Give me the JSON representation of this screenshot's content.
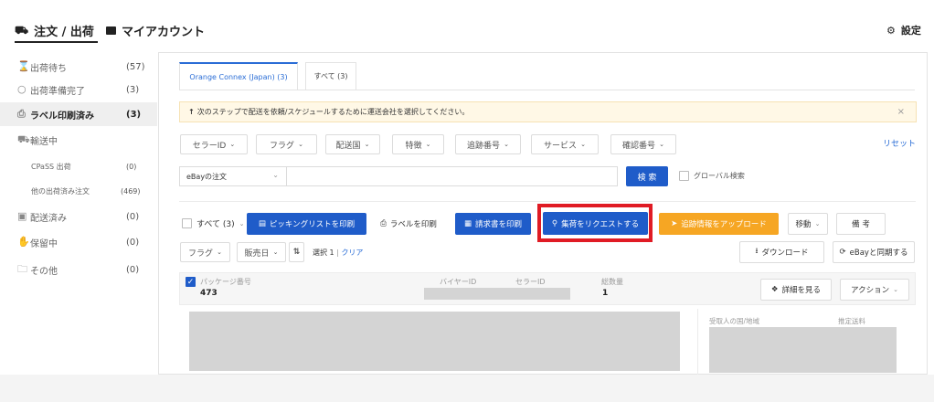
{
  "topnav": {
    "orders_label": "注文 / 出荷",
    "account_label": "マイアカウント",
    "settings_label": "設定"
  },
  "sidebar": {
    "items": [
      {
        "label": "出荷待ち",
        "count": "(57)",
        "icon": "hourglass-icon"
      },
      {
        "label": "出荷準備完了",
        "count": "(3)",
        "icon": "box-icon"
      },
      {
        "label": "ラベル印刷済み",
        "count": "(3)",
        "icon": "printer-icon"
      },
      {
        "label": "輸送中",
        "count": "",
        "icon": "truck-icon"
      },
      {
        "label": "CPaSS 出荷",
        "count": "(0)",
        "icon": ""
      },
      {
        "label": "他の出荷済み注文",
        "count": "(469)",
        "icon": ""
      },
      {
        "label": "配送済み",
        "count": "(0)",
        "icon": "delivered-icon"
      },
      {
        "label": "保留中",
        "count": "(0)",
        "icon": "hand-icon"
      },
      {
        "label": "その他",
        "count": "(0)",
        "icon": "folder-icon"
      }
    ]
  },
  "tabs": [
    {
      "label": "Orange Connex (Japan) (3)"
    },
    {
      "label": "すべて (3)"
    }
  ],
  "notice": {
    "text": "次のステップで配送を依頼/スケジュールするために運送会社を選択してください。",
    "close": "×"
  },
  "filters": {
    "items": [
      "セラーID",
      "フラグ",
      "配送国",
      "特徴",
      "追跡番号",
      "サービス",
      "確認番号"
    ],
    "reset": "リセット"
  },
  "search": {
    "scope": "eBayの注文",
    "button": "検 索",
    "global_label": "グローバル検索"
  },
  "actions": {
    "select_all": "すべて (3)",
    "picking_list": "ピッキングリストを印刷",
    "print_label": "ラベルを印刷",
    "print_invoice": "請求書を印刷",
    "request_pickup": "集荷をリクエストする",
    "upload_tracking": "追跡情報をアップロード",
    "move": "移動",
    "note": "備 考"
  },
  "sort": {
    "flag": "フラグ",
    "sort_by": "販売日",
    "selected": "選択 1",
    "clear": "クリア",
    "download": "ダウンロード",
    "sync": "eBayと同期する"
  },
  "package": {
    "package_label": "パッケージ番号",
    "package_value": "473",
    "buyer_label": "バイヤーID",
    "seller_label": "セラーID",
    "qty_label": "総数量",
    "qty_value": "1",
    "details_button": "詳細を見る",
    "action_button": "アクション",
    "country_label": "受取人の国/地域",
    "fee_label": "推定送料"
  },
  "colors": {
    "accent_blue": "#1f5cc9",
    "highlight_red": "#e01b24",
    "orange": "#f6a623"
  }
}
